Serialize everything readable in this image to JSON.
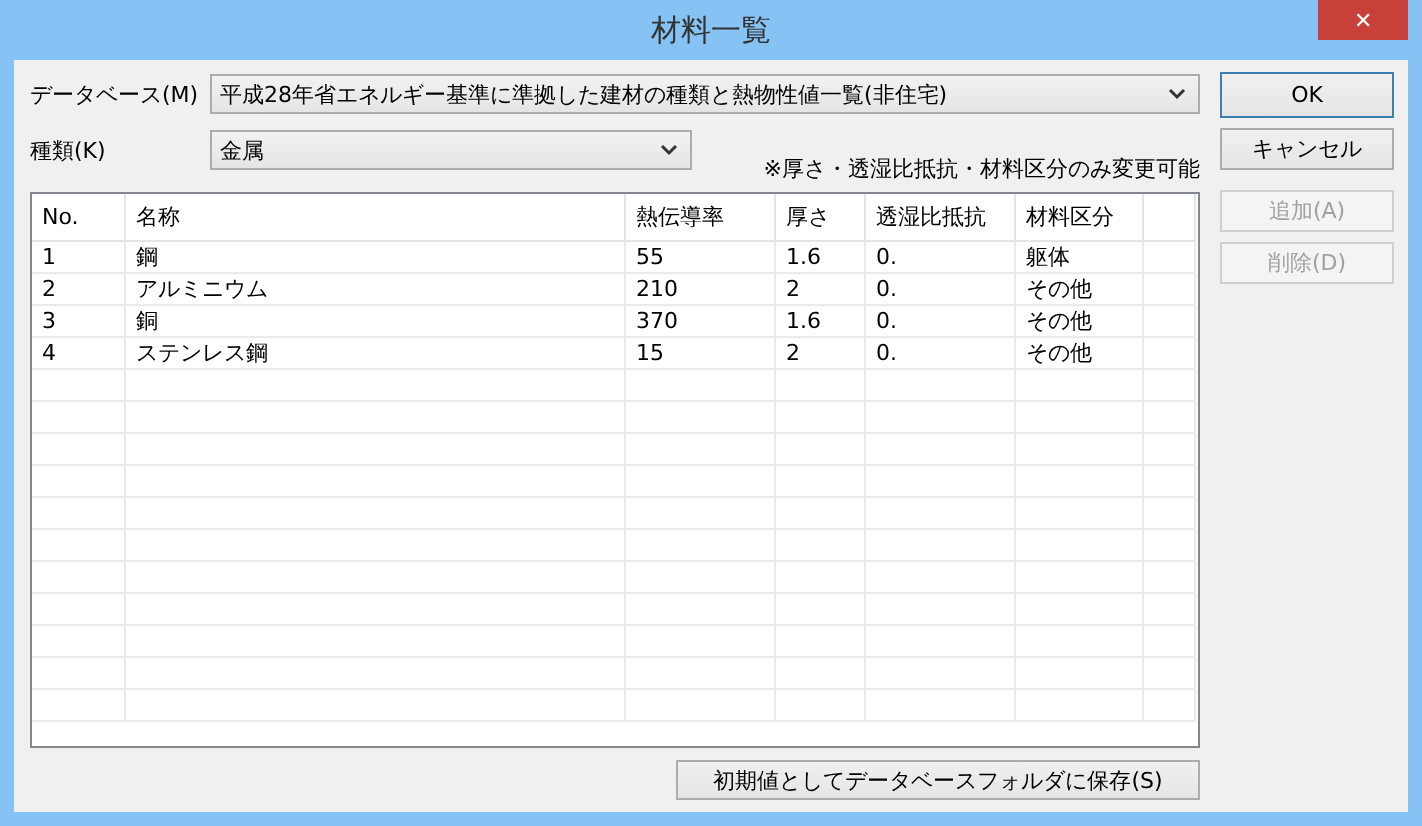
{
  "window": {
    "title": "材料一覧",
    "close": "✕"
  },
  "database": {
    "label": "データベース(M)",
    "value": "平成28年省エネルギー基準に準拠した建材の種類と熱物性値一覧(非住宅)"
  },
  "kind": {
    "label": "種類(K)",
    "value": "金属"
  },
  "note": "※厚さ・透湿比抵抗・材料区分のみ変更可能",
  "table": {
    "columns": [
      "No.",
      "名称",
      "熱伝導率",
      "厚さ",
      "透湿比抵抗",
      "材料区分"
    ],
    "rows": [
      [
        "1",
        "鋼",
        "55",
        "1.6",
        "0.",
        "躯体"
      ],
      [
        "2",
        "アルミニウム",
        "210",
        "2",
        "0.",
        "その他"
      ],
      [
        "3",
        "銅",
        "370",
        "1.6",
        "0.",
        "その他"
      ],
      [
        "4",
        "ステンレス鋼",
        "15",
        "2",
        "0.",
        "その他"
      ]
    ]
  },
  "buttons": [
    {
      "label": "OK",
      "default": true,
      "disabled": false
    },
    {
      "label": "キャンセル",
      "default": false,
      "disabled": false
    },
    {
      "label": "追加(A)",
      "default": false,
      "disabled": true
    },
    {
      "label": "削除(D)",
      "default": false,
      "disabled": true
    }
  ],
  "save_button": "初期値としてデータベースフォルダに保存(S)"
}
